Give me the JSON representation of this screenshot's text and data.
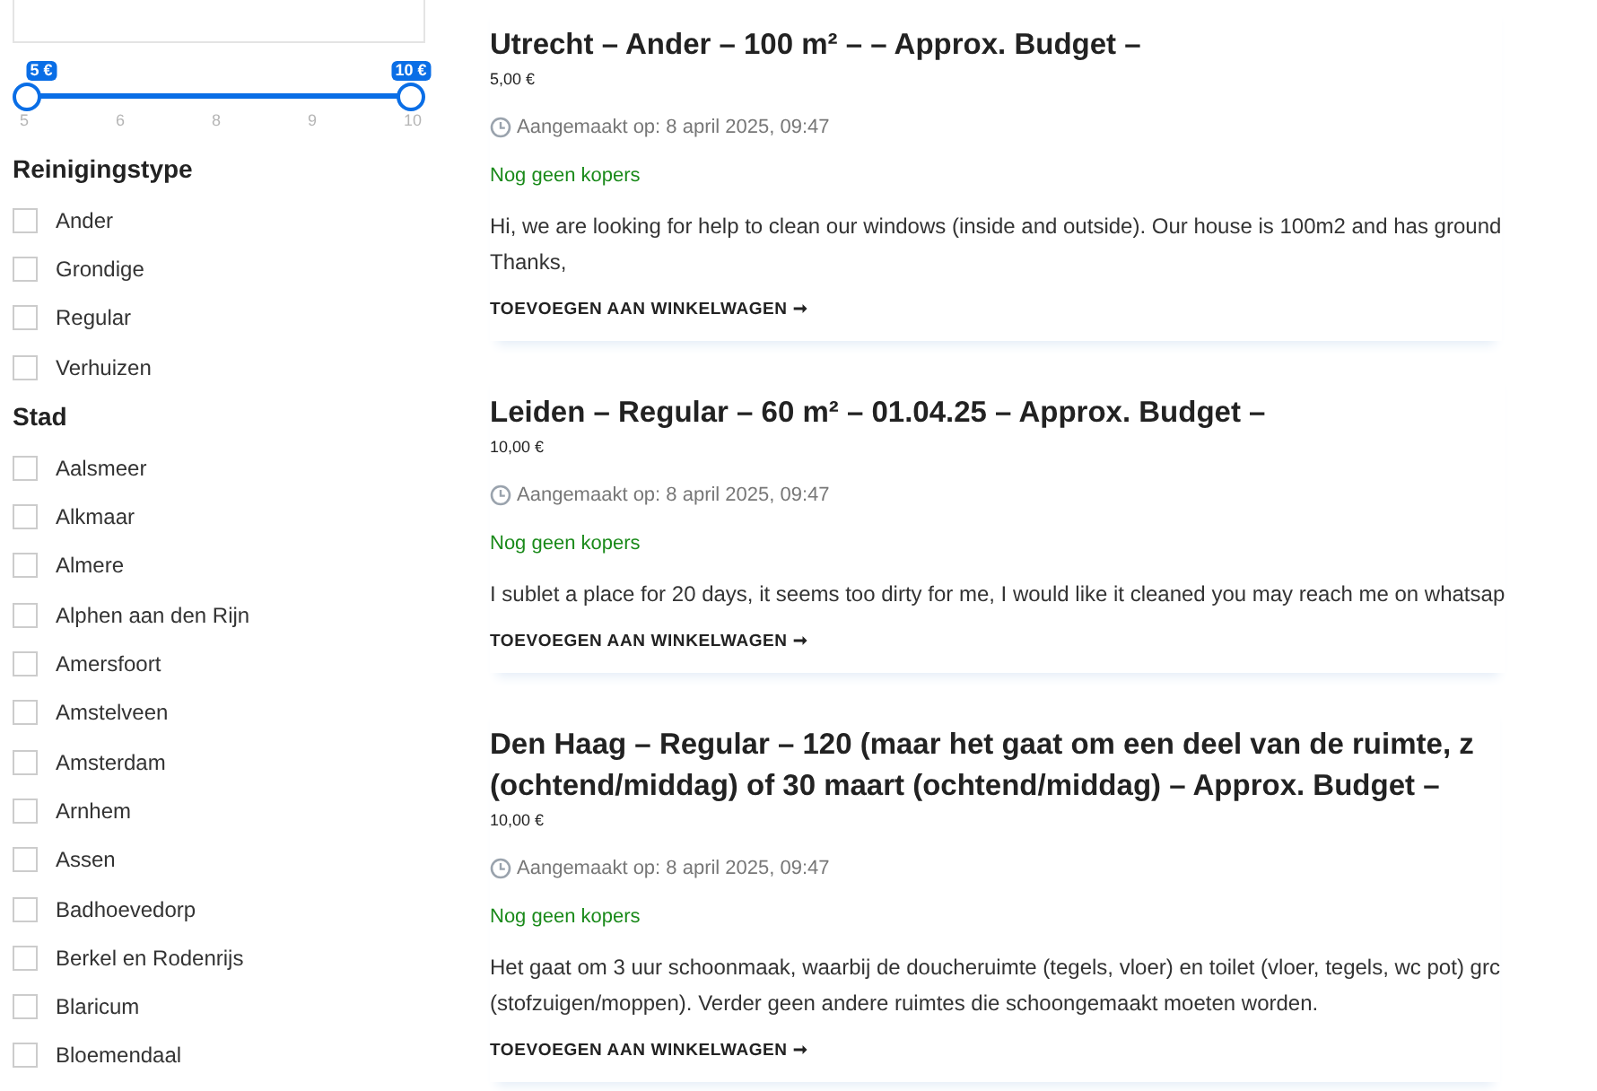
{
  "price_slider": {
    "thumbs": [
      {
        "label": "5 €",
        "level": 0
      },
      {
        "label": "10 €",
        "level": 1
      }
    ],
    "ticks": [
      "5",
      "6",
      "8",
      "9",
      "10"
    ]
  },
  "filters": [
    {
      "heading": "Reinigingstype",
      "options": [
        {
          "label": "Ander",
          "checked": false
        },
        {
          "label": "Grondige",
          "checked": false
        },
        {
          "label": "Regular",
          "checked": false
        },
        {
          "label": "Verhuizen",
          "checked": false
        }
      ]
    },
    {
      "heading": "Stad",
      "options": [
        {
          "label": "Aalsmeer",
          "checked": false
        },
        {
          "label": "Alkmaar",
          "checked": false
        },
        {
          "label": "Almere",
          "checked": false
        },
        {
          "label": "Alphen aan den Rijn",
          "checked": false
        },
        {
          "label": "Amersfoort",
          "checked": false
        },
        {
          "label": "Amstelveen",
          "checked": false
        },
        {
          "label": "Amsterdam",
          "checked": false
        },
        {
          "label": "Arnhem",
          "checked": false
        },
        {
          "label": "Assen",
          "checked": false
        },
        {
          "label": "Badhoevedorp",
          "checked": false
        },
        {
          "label": "Berkel en Rodenrijs",
          "checked": false
        },
        {
          "label": "Blaricum",
          "checked": false
        },
        {
          "label": "Bloemendaal",
          "checked": false
        }
      ]
    }
  ],
  "products": [
    {
      "title_lines": [
        "Utrecht – Ander – 100 m² – – Approx. Budget –"
      ],
      "price": "5,00 €",
      "created": "Aangemaakt op: 8 april 2025, 09:47",
      "buyers": "Nog geen kopers",
      "description_lines": [
        "Hi, we are looking for help to clean our windows (inside and outside). Our house is 100m2 and has ground",
        "Thanks,"
      ],
      "button": "TOEVOEGEN AAN WINKELWAGEN ➞"
    },
    {
      "title_lines": [
        "Leiden – Regular – 60 m² – 01.04.25 – Approx. Budget –"
      ],
      "price": "10,00 €",
      "created": "Aangemaakt op: 8 april 2025, 09:47",
      "buyers": "Nog geen kopers",
      "description_lines": [
        "I sublet a place for 20 days, it seems too dirty for me, I would like it cleaned you may reach me on whatsap"
      ],
      "button": "TOEVOEGEN AAN WINKELWAGEN ➞"
    },
    {
      "title_lines": [
        "Den Haag – Regular – 120 (maar het gaat om een deel van de ruimte, z",
        "(ochtend/middag) of 30 maart (ochtend/middag) – Approx. Budget –"
      ],
      "price": "10,00 €",
      "created": "Aangemaakt op: 8 april 2025, 09:47",
      "buyers": "Nog geen kopers",
      "description_lines": [
        "Het gaat om 3 uur schoonmaak, waarbij de doucheruimte (tegels, vloer) en toilet (vloer, tegels, wc pot) grc",
        "(stofzuigen/moppen). Verder geen andere ruimtes die schoongemaakt moeten worden."
      ],
      "button": "TOEVOEGEN AAN WINKELWAGEN ➞"
    }
  ]
}
